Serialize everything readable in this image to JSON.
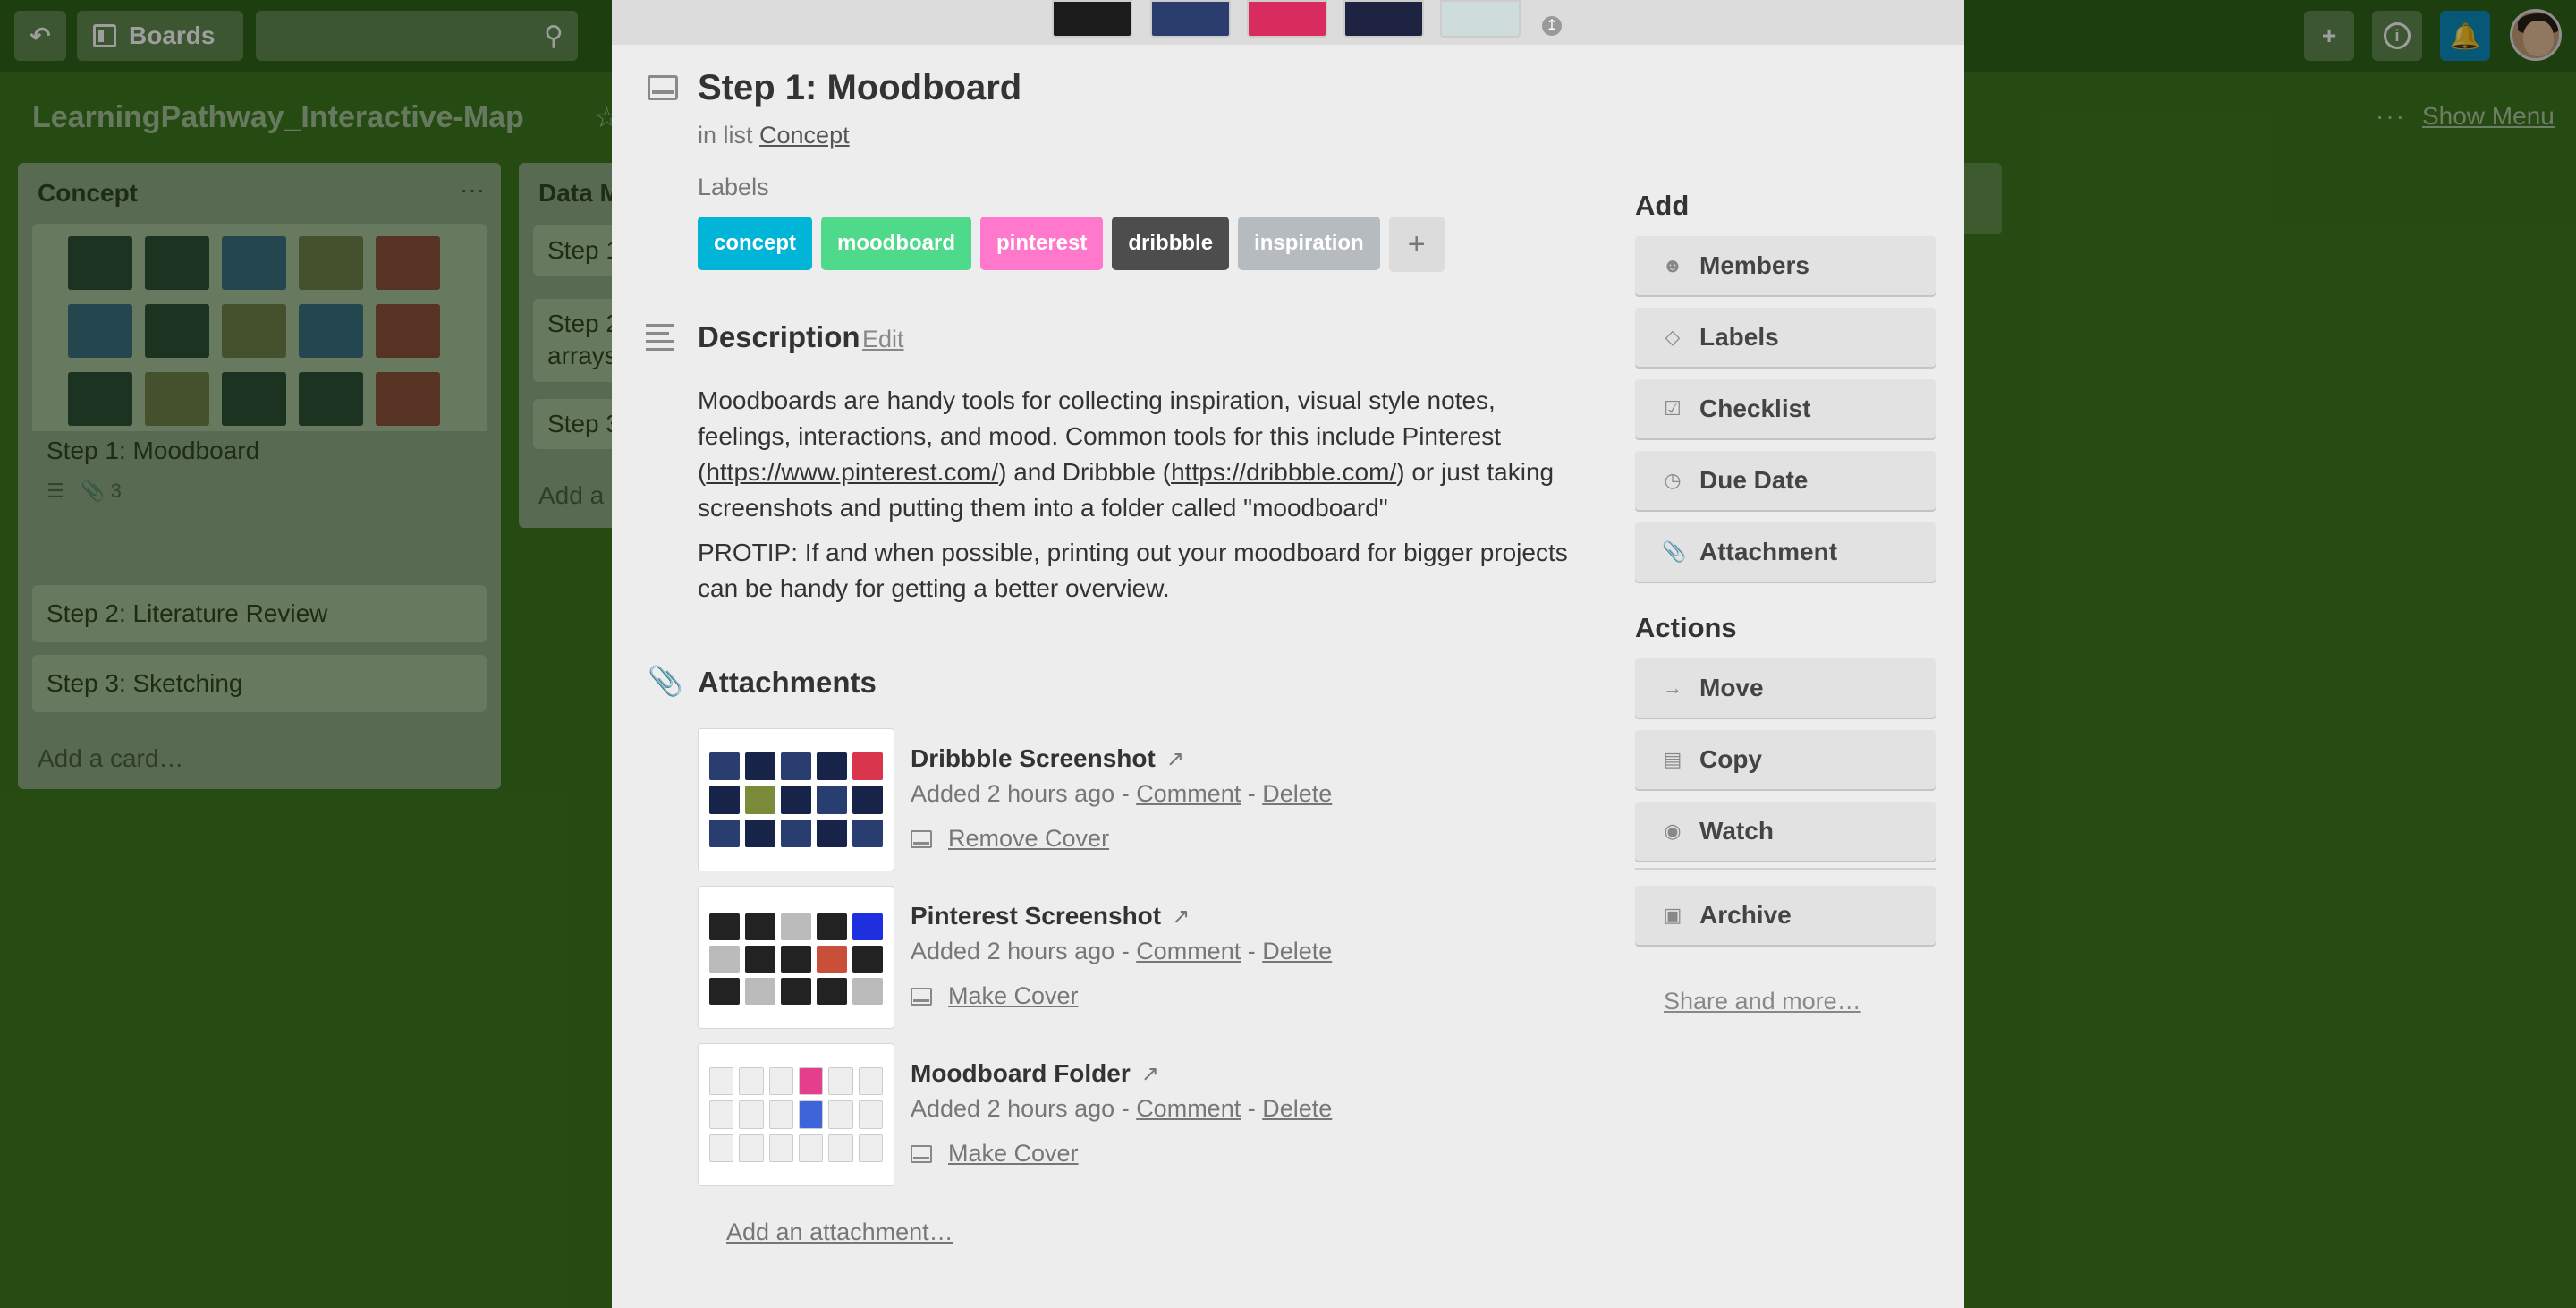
{
  "topbar": {
    "boards_label": "Boards",
    "search_placeholder": ""
  },
  "board": {
    "title": "LearningPathway_Interactive-Map",
    "show_menu_label": "Show Menu",
    "lists": [
      {
        "name": "Concept",
        "cards": [
          "Step 1: Moodboard",
          "Step 2: Literature Review",
          "Step 3: Sketching"
        ],
        "attachment_count": "3",
        "add_card": "Add a card…"
      },
      {
        "name": "Data M",
        "cards": [
          "Step 1",
          "Step 2 arrays",
          "Step 3"
        ],
        "add_card": "Add a"
      }
    ]
  },
  "modal": {
    "title": "Step 1: Moodboard",
    "in_list_prefix": "in list",
    "list_name": "Concept",
    "labels_heading": "Labels",
    "labels": [
      {
        "text": "concept",
        "color": "#00b5d8"
      },
      {
        "text": "moodboard",
        "color": "#4fd98b"
      },
      {
        "text": "pinterest",
        "color": "#ff78cb"
      },
      {
        "text": "dribbble",
        "color": "#4d4d4d"
      },
      {
        "text": "inspiration",
        "color": "#b6bbbf"
      }
    ],
    "label_add": "+",
    "description_heading": "Description",
    "description_edit": "Edit",
    "description": {
      "p1_part1": "Moodboards are handy tools for collecting inspiration, visual style notes, feelings, interactions, and mood. Common tools for this include Pinterest (",
      "pinterest_url": "https://www.pinterest.com/",
      "p1_part2": ") and Dribbble (",
      "dribbble_url": "https://dribbble.com/",
      "p1_part3": ") or just taking screenshots and putting them into a folder called \"moodboard\"",
      "p2": "PROTIP: If and when possible, printing out your moodboard for bigger projects can be handy for getting a better overview."
    },
    "attachments_heading": "Attachments",
    "attachments": [
      {
        "title": "Dribbble Screenshot",
        "added": "Added 2 hours ago",
        "comment": "Comment",
        "delete": "Delete",
        "cover_action": "Remove Cover"
      },
      {
        "title": "Pinterest Screenshot",
        "added": "Added 2 hours ago",
        "comment": "Comment",
        "delete": "Delete",
        "cover_action": "Make Cover"
      },
      {
        "title": "Moodboard Folder",
        "added": "Added 2 hours ago",
        "comment": "Comment",
        "delete": "Delete",
        "cover_action": "Make Cover"
      }
    ],
    "add_attachment": "Add an attachment…",
    "sidebar": {
      "add_heading": "Add",
      "add_buttons": [
        "Members",
        "Labels",
        "Checklist",
        "Due Date",
        "Attachment"
      ],
      "actions_heading": "Actions",
      "action_buttons": [
        "Move",
        "Copy",
        "Watch"
      ],
      "archive": "Archive",
      "share": "Share and more…"
    }
  }
}
